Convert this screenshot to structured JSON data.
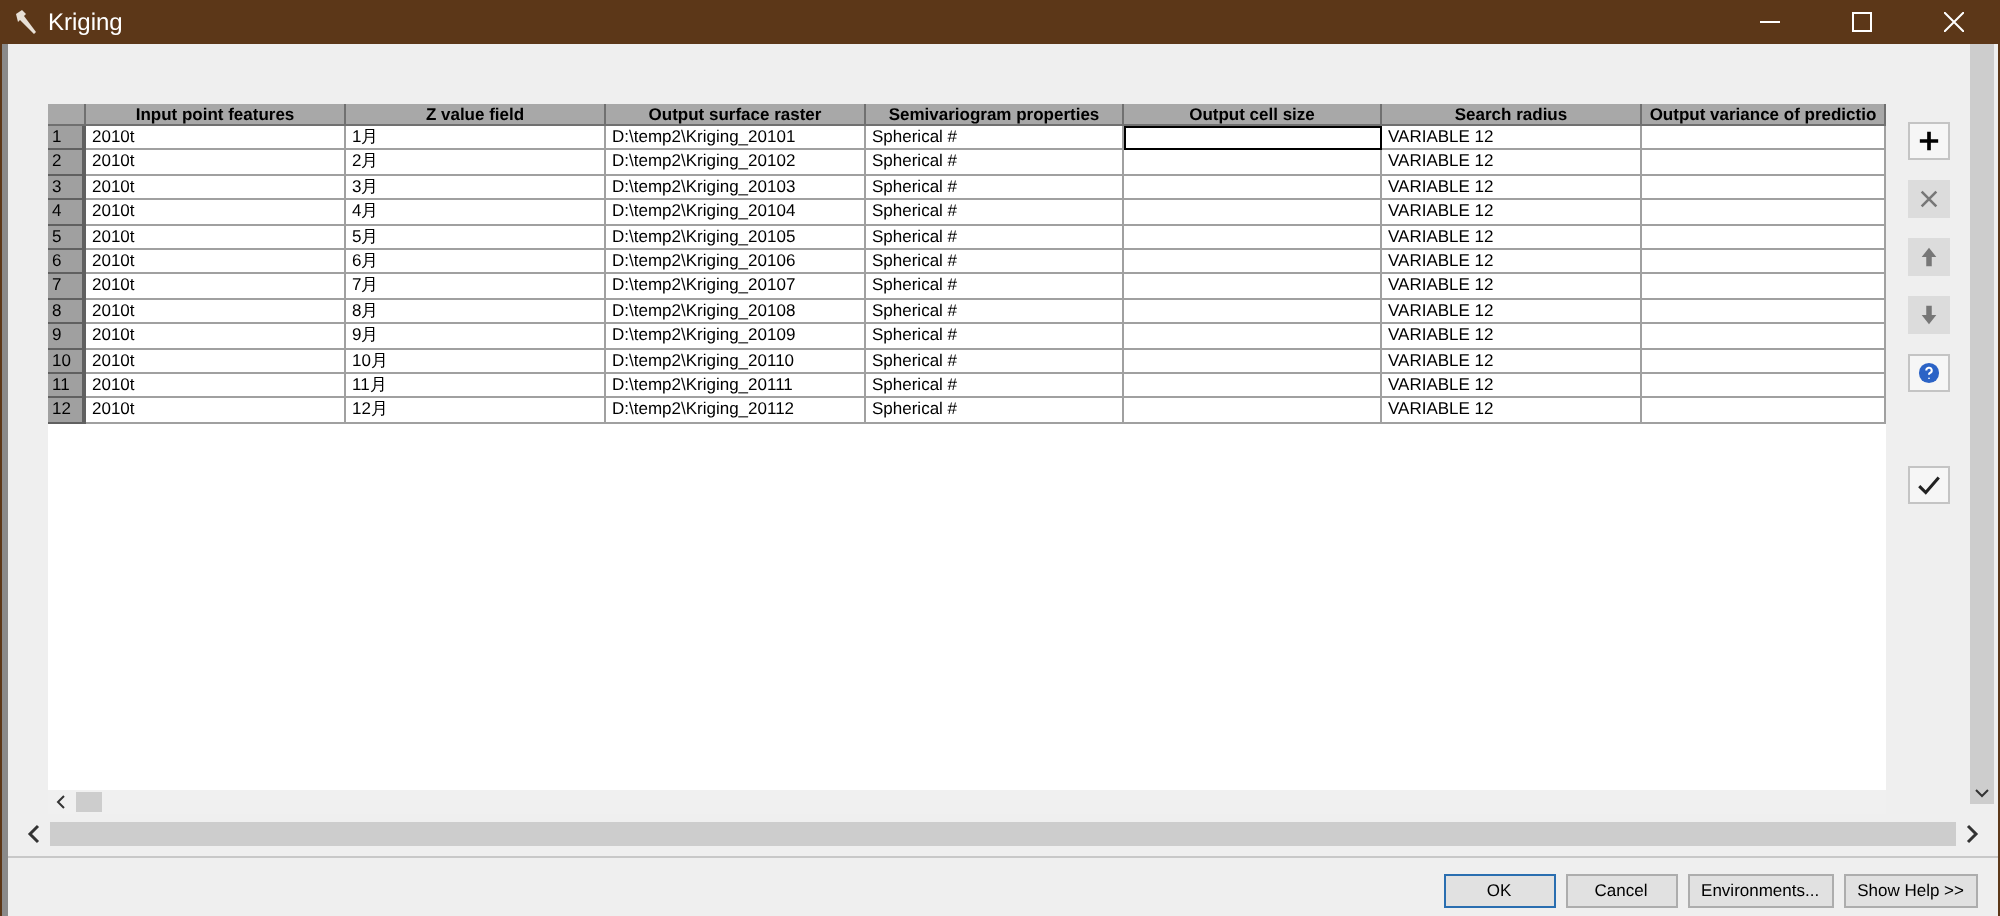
{
  "window": {
    "title": "Kriging"
  },
  "table": {
    "columns": [
      "Input point features",
      "Z value field",
      "Output surface raster",
      "Semivariogram properties",
      "Output cell size",
      "Search radius",
      "Output variance of predictio"
    ],
    "rows": [
      {
        "number": "1",
        "input": "2010t",
        "z": "1月",
        "output": "D:\\temp2\\Kriging_20101",
        "semivariogram": "Spherical #",
        "radius": "VARIABLE 12",
        "focused": true
      },
      {
        "number": "2",
        "input": "2010t",
        "z": "2月",
        "output": "D:\\temp2\\Kriging_20102",
        "semivariogram": "Spherical #",
        "radius": "VARIABLE 12",
        "focused": false
      },
      {
        "number": "3",
        "input": "2010t",
        "z": "3月",
        "output": "D:\\temp2\\Kriging_20103",
        "semivariogram": "Spherical #",
        "radius": "VARIABLE 12",
        "focused": false
      },
      {
        "number": "4",
        "input": "2010t",
        "z": "4月",
        "output": "D:\\temp2\\Kriging_20104",
        "semivariogram": "Spherical #",
        "radius": "VARIABLE 12",
        "focused": false
      },
      {
        "number": "5",
        "input": "2010t",
        "z": "5月",
        "output": "D:\\temp2\\Kriging_20105",
        "semivariogram": "Spherical #",
        "radius": "VARIABLE 12",
        "focused": false
      },
      {
        "number": "6",
        "input": "2010t",
        "z": "6月",
        "output": "D:\\temp2\\Kriging_20106",
        "semivariogram": "Spherical #",
        "radius": "VARIABLE 12",
        "focused": false
      },
      {
        "number": "7",
        "input": "2010t",
        "z": "7月",
        "output": "D:\\temp2\\Kriging_20107",
        "semivariogram": "Spherical #",
        "radius": "VARIABLE 12",
        "focused": false
      },
      {
        "number": "8",
        "input": "2010t",
        "z": "8月",
        "output": "D:\\temp2\\Kriging_20108",
        "semivariogram": "Spherical #",
        "radius": "VARIABLE 12",
        "focused": false
      },
      {
        "number": "9",
        "input": "2010t",
        "z": "9月",
        "output": "D:\\temp2\\Kriging_20109",
        "semivariogram": "Spherical #",
        "radius": "VARIABLE 12",
        "focused": false
      },
      {
        "number": "10",
        "input": "2010t",
        "z": "10月",
        "output": "D:\\temp2\\Kriging_20110",
        "semivariogram": "Spherical #",
        "radius": "VARIABLE 12",
        "focused": false
      },
      {
        "number": "11",
        "input": "2010t",
        "z": "11月",
        "output": "D:\\temp2\\Kriging_20111",
        "semivariogram": "Spherical #",
        "radius": "VARIABLE 12",
        "focused": false
      },
      {
        "number": "12",
        "input": "2010t",
        "z": "12月",
        "output": "D:\\temp2\\Kriging_20112",
        "semivariogram": "Spherical #",
        "radius": "VARIABLE 12",
        "focused": false
      }
    ]
  },
  "side_tools": [
    {
      "kind": "add",
      "disabled": false
    },
    {
      "kind": "remove",
      "disabled": true
    },
    {
      "kind": "up",
      "disabled": true
    },
    {
      "kind": "down",
      "disabled": true
    },
    {
      "kind": "help",
      "disabled": false
    },
    {
      "kind": "check",
      "disabled": false
    }
  ],
  "buttons": [
    {
      "label": "OK",
      "default": true
    },
    {
      "label": "Cancel",
      "default": false
    },
    {
      "label": "Environments...",
      "default": false
    },
    {
      "label": "Show Help >>",
      "default": false
    }
  ]
}
